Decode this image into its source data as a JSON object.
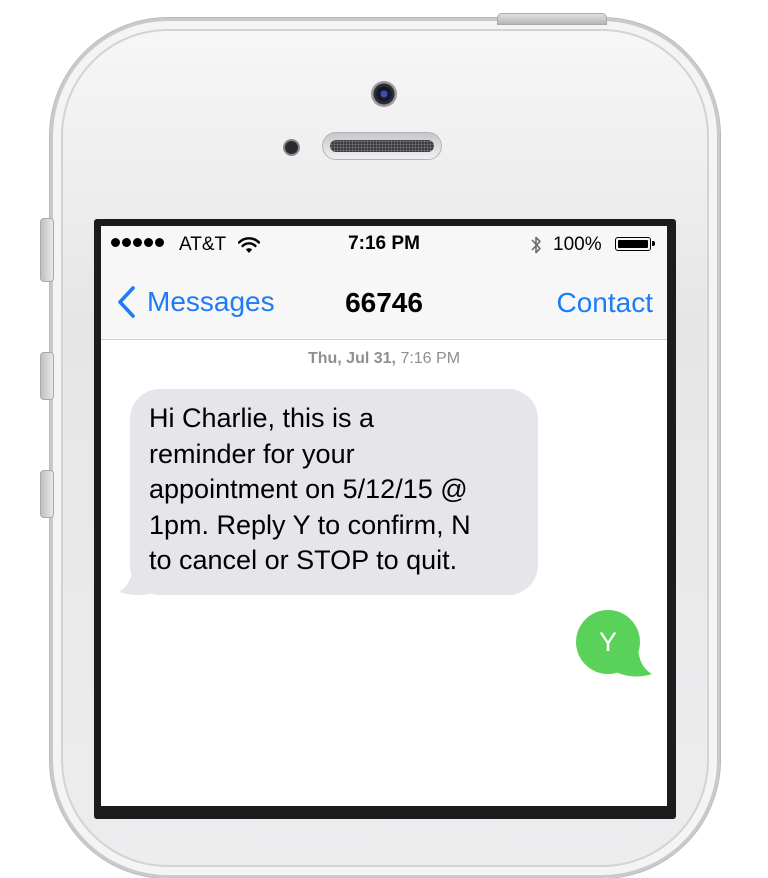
{
  "status_bar": {
    "carrier": "AT&T",
    "time": "7:16 PM",
    "battery": "100%"
  },
  "nav": {
    "back_label": "Messages",
    "title": "66746",
    "contact_label": "Contact"
  },
  "conversation": {
    "timestamp_date": "Thu, Jul 31,",
    "timestamp_time": "7:16 PM",
    "messages": [
      {
        "direction": "incoming",
        "lines": [
          "Hi Charlie, this is a",
          "reminder for your",
          "appointment on 5/12/15 @",
          "1pm. Reply Y to confirm, N",
          "to cancel or STOP to quit."
        ]
      },
      {
        "direction": "outgoing",
        "text": "Y"
      }
    ]
  },
  "colors": {
    "ios_blue": "#1e7cf6",
    "incoming_bubble": "#e5e5ea",
    "outgoing_bubble": "#5ad25a",
    "timestamp_gray": "#8e8e93"
  },
  "icons": [
    "signal-dots-icon",
    "wifi-icon",
    "bluetooth-icon",
    "battery-icon",
    "chevron-left-icon"
  ]
}
